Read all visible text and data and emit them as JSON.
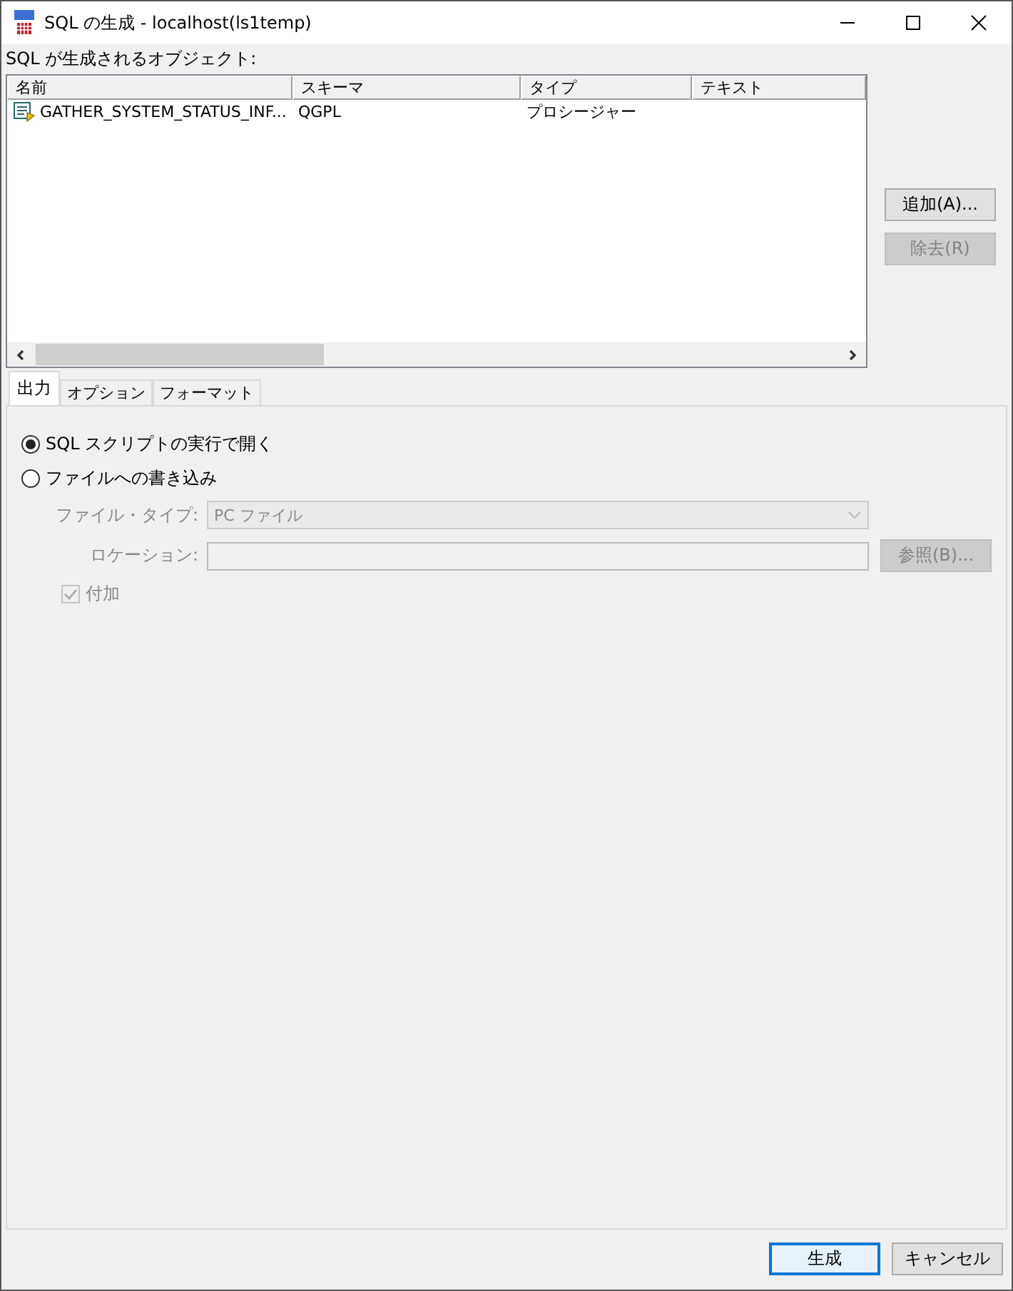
{
  "window": {
    "title": "SQL の生成 - localhost(ls1temp)"
  },
  "objects_label": "SQL が生成されるオブジェクト:",
  "table": {
    "columns": [
      "名前",
      "スキーマ",
      "タイプ",
      "テキスト"
    ],
    "rows": [
      {
        "cells": [
          "GATHER_SYSTEM_STATUS_INF...",
          "QGPL",
          "プロシージャー",
          ""
        ]
      }
    ]
  },
  "side_buttons": [
    {
      "label": "追加(A)...",
      "disabled": false
    },
    {
      "label": "除去(R)",
      "disabled": true
    }
  ],
  "tabs": [
    {
      "label": "出力",
      "selected": true
    },
    {
      "label": "オプション",
      "selected": false
    },
    {
      "label": "フォーマット",
      "selected": false
    }
  ],
  "output_options": [
    {
      "label": "SQL スクリプトの実行で開く",
      "selected": true
    },
    {
      "label": "ファイルへの書き込み",
      "selected": false
    }
  ],
  "file_type": {
    "label": "ファイル・タイプ:",
    "value": "PC ファイル",
    "disabled": true
  },
  "location": {
    "label": "ロケーション:",
    "disabled": true
  },
  "browse_button": {
    "label": "参照(B)...",
    "disabled": true
  },
  "append": {
    "label": "付加",
    "checked": true,
    "disabled": true
  },
  "footer_buttons": [
    {
      "label": "生成",
      "default": true
    },
    {
      "label": "キャンセル",
      "default": false
    }
  ]
}
